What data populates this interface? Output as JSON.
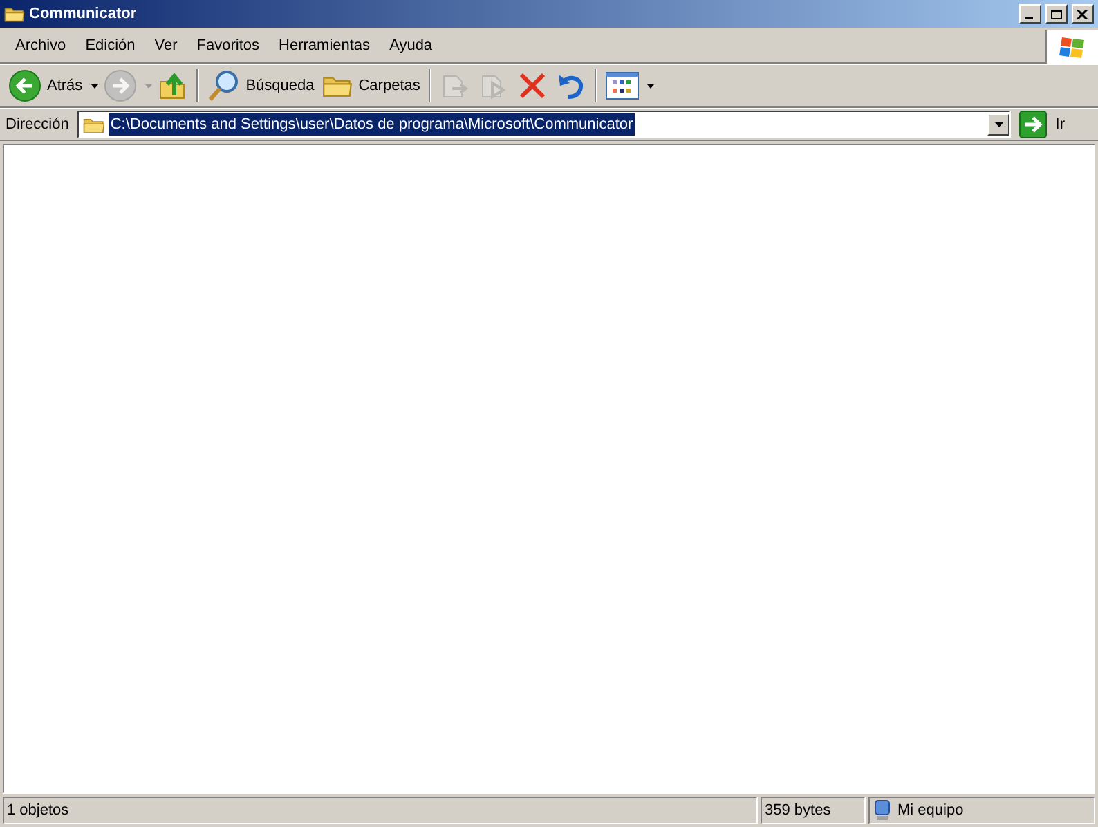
{
  "window": {
    "title": "Communicator"
  },
  "menu": [
    "Archivo",
    "Edición",
    "Ver",
    "Favoritos",
    "Herramientas",
    "Ayuda"
  ],
  "toolbar": [
    {
      "kind": "back",
      "label": "Atrás",
      "disabled": false,
      "dropdown": true
    },
    {
      "kind": "forward",
      "disabled": true,
      "dropdown": true
    },
    {
      "kind": "up",
      "disabled": false
    },
    {
      "kind": "separator"
    },
    {
      "kind": "search",
      "label": "Búsqueda",
      "disabled": false
    },
    {
      "kind": "folders",
      "label": "Carpetas",
      "disabled": false
    },
    {
      "kind": "separator"
    },
    {
      "kind": "move",
      "disabled": true
    },
    {
      "kind": "copy",
      "disabled": true
    },
    {
      "kind": "delete",
      "disabled": false
    },
    {
      "kind": "undo",
      "disabled": false
    },
    {
      "kind": "separator"
    },
    {
      "kind": "views",
      "disabled": false,
      "dropdown": true
    }
  ],
  "address": {
    "label": "Dirección",
    "value": "C:\\Documents and Settings\\user\\Datos de programa\\Microsoft\\Communicator",
    "selected": true,
    "go": "Ir"
  },
  "status_bar": {
    "objects": "1 objetos",
    "size": "359 bytes",
    "location": "Mi equipo"
  }
}
